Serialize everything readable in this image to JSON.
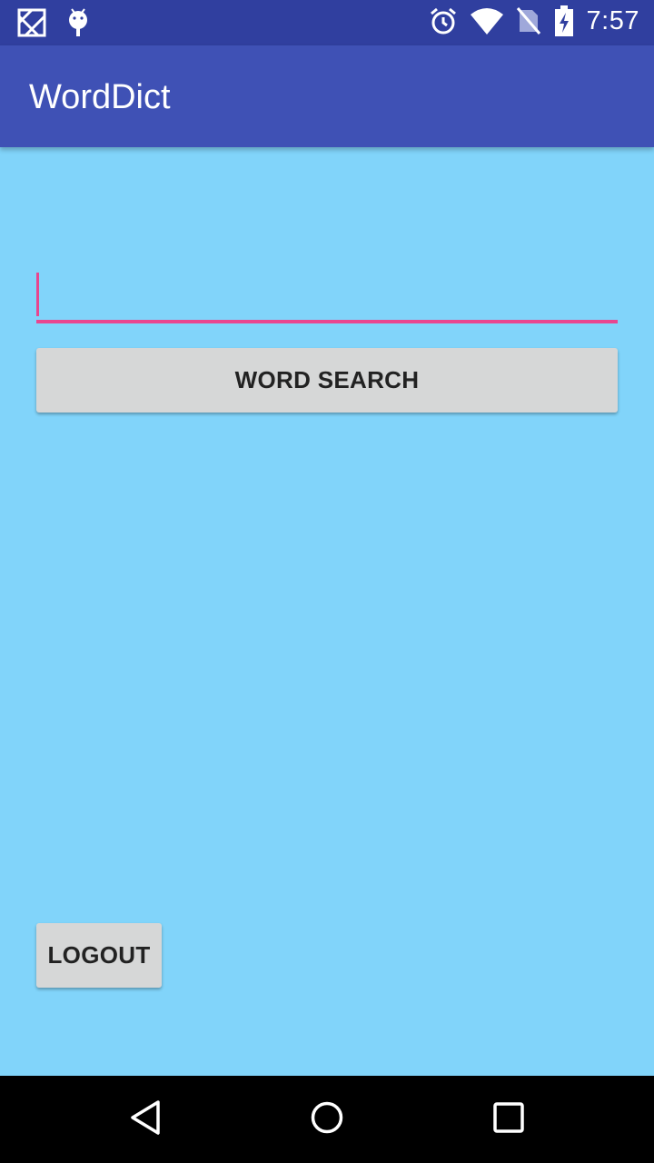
{
  "status_bar": {
    "time": "7:57",
    "left_icons": [
      "photos-icon",
      "android-debug-icon"
    ],
    "right_icons": [
      "alarm-icon",
      "wifi-icon",
      "no-sim-icon",
      "battery-charging-icon"
    ]
  },
  "app_bar": {
    "title": "WordDict"
  },
  "search": {
    "value": "",
    "placeholder": ""
  },
  "buttons": {
    "word_search": "WORD SEARCH",
    "logout": "LOGOUT"
  },
  "nav_bar": {
    "icons": [
      "back-icon",
      "home-icon",
      "recents-icon"
    ]
  },
  "colors": {
    "status_bar": "#303F9F",
    "app_bar": "#3F51B5",
    "background": "#81D4FA",
    "accent": "#E8468F",
    "button": "#D6D7D7"
  }
}
